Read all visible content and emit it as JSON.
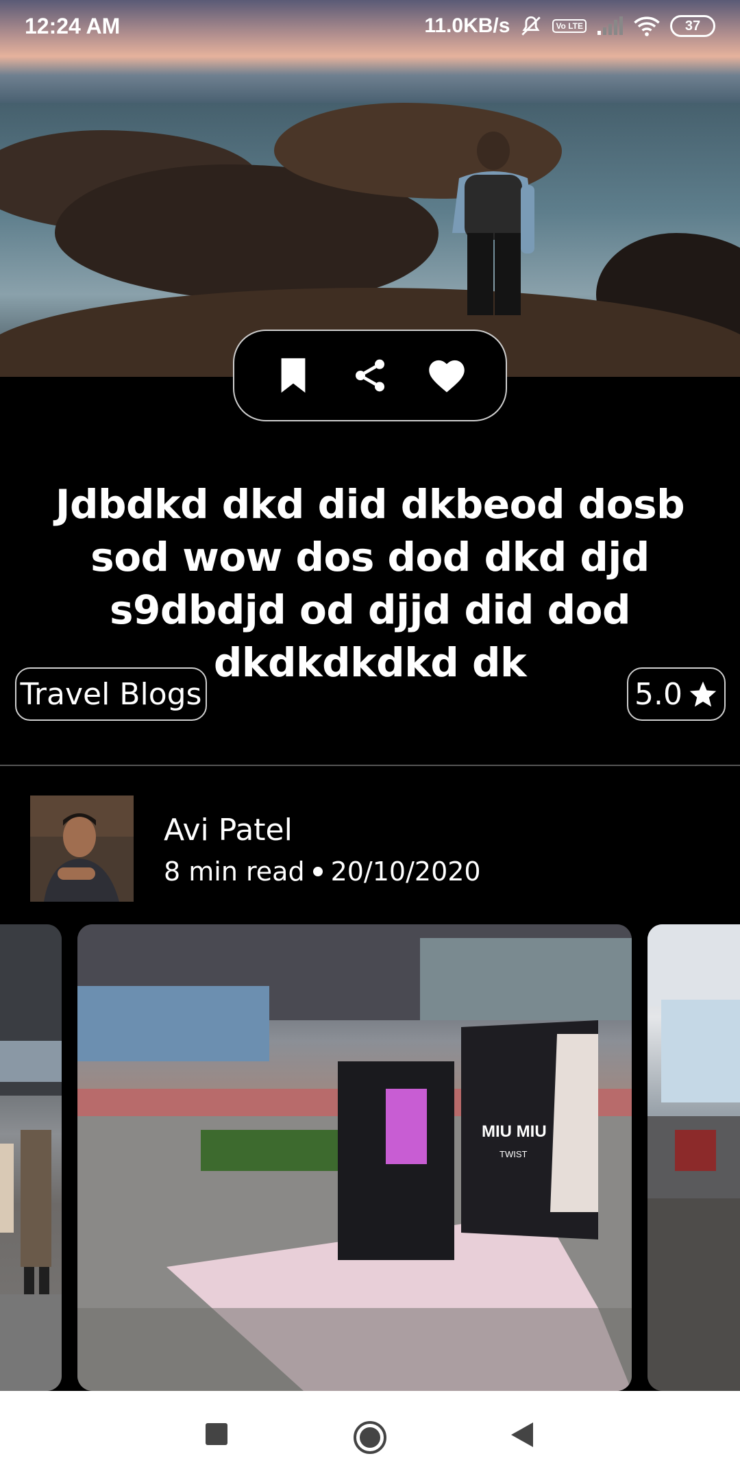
{
  "status_bar": {
    "time": "12:24 AM",
    "network_speed": "11.0KB/s",
    "lte_badge": "Vo LTE",
    "battery": "37",
    "icons": [
      "mute-icon",
      "lte-icon",
      "signal-icon",
      "wifi-icon",
      "battery-icon"
    ]
  },
  "hero": {
    "actions": [
      "bookmark-icon",
      "share-icon",
      "heart-icon"
    ]
  },
  "post": {
    "title": "Jdbdkd dkd did dkbeod dosb sod wow dos dod dkd djd s9dbdjd od djjd did dod dkdkdkdkd dk",
    "category": "Travel Blogs",
    "rating": "5.0"
  },
  "author": {
    "name": "Avi Patel",
    "read_time": "8 min read",
    "date": "20/10/2020"
  },
  "gallery": {
    "slide_count": 3,
    "main_sign_text": "MIU MIU",
    "main_sub_text": "TWIST"
  },
  "nav_bar": {
    "buttons": [
      "recents-icon",
      "home-icon",
      "back-icon"
    ]
  },
  "colors": {
    "background": "#000000",
    "text": "#ffffff",
    "chip_border": "#cfcfcf",
    "nav_bar": "#ffffff"
  }
}
